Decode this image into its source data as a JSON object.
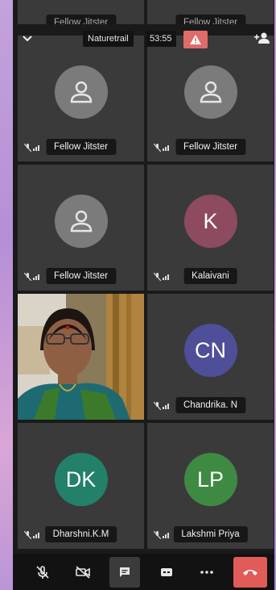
{
  "header": {
    "room_name": "Naturetrail",
    "elapsed_time": "53:55"
  },
  "tiles": [
    {
      "name": "Fellow Jitster",
      "avatar": "person-icon"
    },
    {
      "name": "Fellow Jitster",
      "avatar": "person-icon"
    },
    {
      "name": "Fellow Jitster",
      "avatar": "person-icon"
    },
    {
      "name": "Kalaivani",
      "initials": "K",
      "color": "#8e4a5e"
    },
    {
      "name": "",
      "video": true
    },
    {
      "name": "Chandrika. N",
      "initials": "CN",
      "color": "#4f4e99"
    },
    {
      "name": "Dharshni.K.M",
      "initials": "DK",
      "color": "#23806b"
    },
    {
      "name": "Lakshmi Priya",
      "initials": "LP",
      "color": "#3f8a43"
    }
  ],
  "colors": {
    "warning": "#e06b6b",
    "hangup": "#e15b58",
    "tile_bg": "#3a3a3a"
  },
  "toolbar": {
    "buttons": [
      "mic-muted-icon",
      "camera-off-icon",
      "chat-icon",
      "tile-view-icon",
      "more-icon",
      "hangup-icon"
    ]
  }
}
